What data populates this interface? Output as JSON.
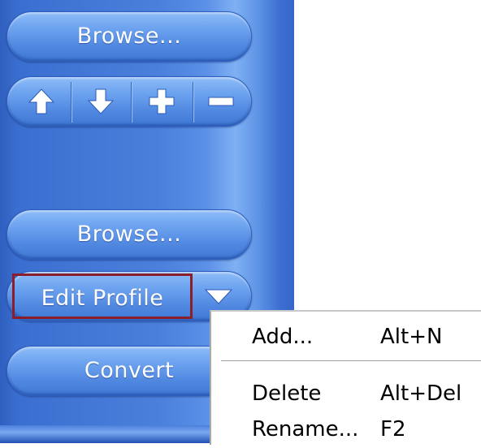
{
  "panel": {
    "browse_top_label": "Browse...",
    "browse_bottom_label": "Browse...",
    "edit_profile_label": "Edit Profile",
    "convert_label": "Convert",
    "arrow_buttons": [
      "up-arrow-icon",
      "down-arrow-icon",
      "plus-icon",
      "minus-icon"
    ]
  },
  "context_menu": {
    "items": [
      {
        "label": "Add...",
        "shortcut": "Alt+N"
      },
      {
        "label": "Delete",
        "shortcut": "Alt+Del"
      },
      {
        "label": "Rename...",
        "shortcut": "F2"
      }
    ]
  },
  "colors": {
    "panel_blue": "#4b80dc",
    "button_blue": "#6fa5f0",
    "highlight_border": "#8a1f2b"
  }
}
